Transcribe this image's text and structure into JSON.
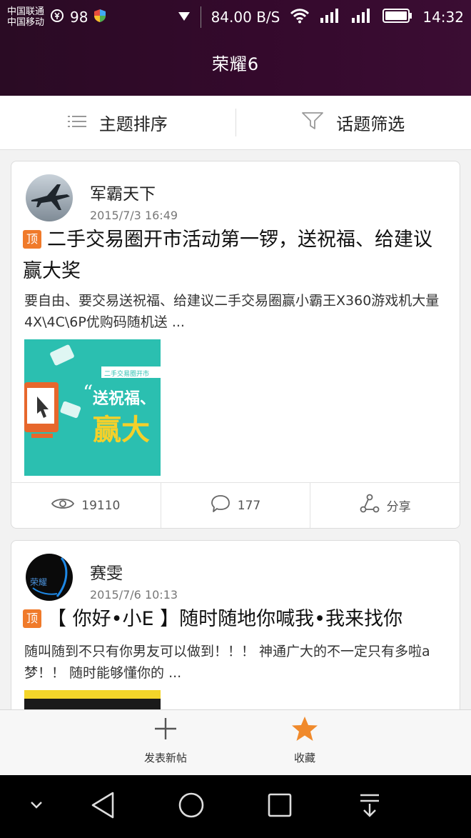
{
  "status": {
    "carrier1": "中国联通",
    "carrier2": "中国移动",
    "battery_small": "98",
    "net_speed": "84.00 B/S",
    "time": "14:32"
  },
  "header": {
    "title": "荣耀6"
  },
  "filter": {
    "sort_label": "主题排序",
    "filter_label": "话题筛选"
  },
  "posts": [
    {
      "author": "军霸天下",
      "date": "2015/7/3 16:49",
      "pin": "顶",
      "title": "二手交易圈开市活动第一锣，送祝福、给建议赢大奖",
      "excerpt": "要自由、要交易送祝福、给建议二手交易圈赢小霸王X360游戏机大量4X\\4C\\6P优购码随机送 ...",
      "thumb_text_small": "二手交易圈开市",
      "thumb_text_mid": "送祝福、",
      "thumb_text_big": "赢大",
      "views": "19110",
      "comments": "177",
      "share": "分享"
    },
    {
      "author": "赛雯",
      "date": "2015/7/6 10:13",
      "pin": "顶",
      "title": "【 你好•小E 】随时随地你喊我•我来找你",
      "excerpt": "随叫随到不只有你男友可以做到！！！ 神通广大的不一定只有多啦a梦！！ 随时能够懂你的 ...",
      "avatar_text": "荣耀"
    }
  ],
  "toolbar": {
    "new_post": "发表新帖",
    "favorites": "收藏"
  },
  "colors": {
    "accent": "#f07a2a",
    "header_bg": "#2e0a28"
  }
}
